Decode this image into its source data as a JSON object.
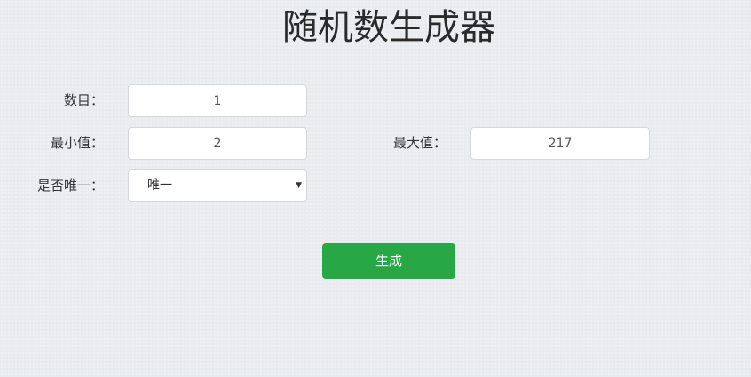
{
  "title": "随机数生成器",
  "form": {
    "count_label": "数目：",
    "count_value": "1",
    "min_label": "最小值：",
    "min_value": "2",
    "max_label": "最大值：",
    "max_value": "217",
    "unique_label": "是否唯一：",
    "unique_selected": "唯一"
  },
  "actions": {
    "generate_label": "生成"
  },
  "colors": {
    "background": "#e9ecef",
    "button": "#28a745",
    "button_text": "#ffffff"
  },
  "icons": {
    "dropdown": "chevron-down-icon"
  }
}
